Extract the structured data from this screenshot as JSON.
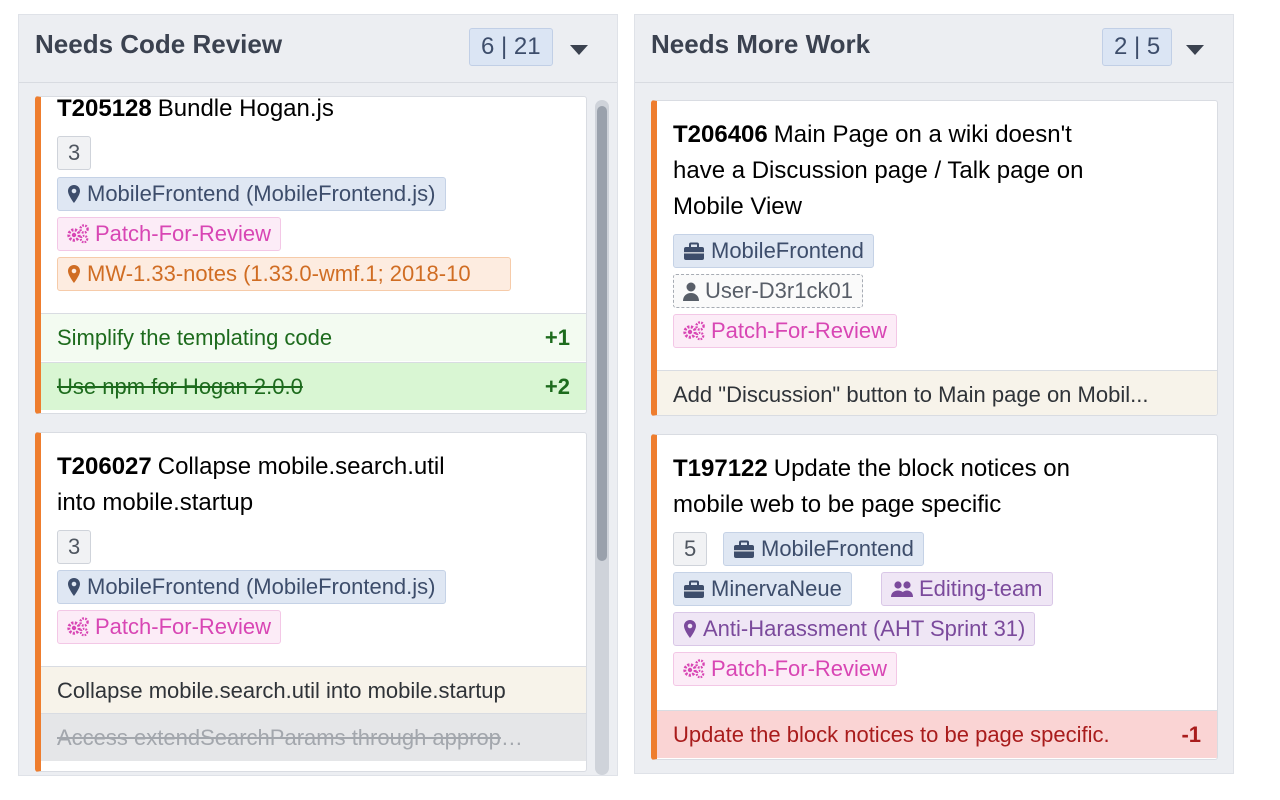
{
  "columns": [
    {
      "title": "Needs Code Review",
      "count": "6 | 21",
      "cards": [
        {
          "id": "T205128",
          "title": "Bundle Hogan.js",
          "points": "3",
          "tags": [
            {
              "label": "MobileFrontend (MobileFrontend.js)",
              "icon": "map-pin-icon"
            },
            {
              "label": "Patch-For-Review",
              "icon": "cogs-icon"
            },
            {
              "label": "MW-1.33-notes (1.33.0-wmf.1; 2018-10",
              "icon": "map-pin-icon"
            }
          ],
          "revisions": [
            {
              "text": "Simplify the templating code",
              "score": "+1"
            },
            {
              "text": "Use npm for Hogan 2.0.0",
              "score": "+2"
            }
          ]
        },
        {
          "id": "T206027",
          "title_line1": "Collapse mobile.search.util",
          "title_line2": "into mobile.startup",
          "points": "3",
          "tags": [
            {
              "label": "MobileFrontend (MobileFrontend.js)",
              "icon": "map-pin-icon"
            },
            {
              "label": "Patch-For-Review",
              "icon": "cogs-icon"
            }
          ],
          "revisions": [
            {
              "text": "Collapse mobile.search.util into mobile.startup",
              "score": ""
            },
            {
              "text": "Access extendSearchParams through appropri...",
              "score": ""
            }
          ]
        }
      ]
    },
    {
      "title": "Needs More Work",
      "count": "2 | 5",
      "cards": [
        {
          "id": "T206406",
          "title_line1": "Main Page on a wiki doesn't",
          "title_line2": "have a Discussion page / Talk page on",
          "title_line3": "Mobile View",
          "tags": [
            {
              "label": "MobileFrontend",
              "icon": "briefcase-icon"
            },
            {
              "label": "User-D3r1ck01",
              "icon": "user-icon"
            },
            {
              "label": "Patch-For-Review",
              "icon": "cogs-icon"
            }
          ],
          "revisions": [
            {
              "text": "Add \"Discussion\" button to Main page on Mobil...",
              "score": ""
            }
          ]
        },
        {
          "id": "T197122",
          "title_line1": "Update the block notices on",
          "title_line2": "mobile web to be page specific",
          "points": "5",
          "tags": [
            {
              "label": "MobileFrontend",
              "icon": "briefcase-icon"
            },
            {
              "label": "MinervaNeue",
              "icon": "briefcase-icon"
            },
            {
              "label": "Editing-team",
              "icon": "users-icon"
            },
            {
              "label": "Anti-Harassment (AHT Sprint 31)",
              "icon": "map-pin-icon"
            },
            {
              "label": "Patch-For-Review",
              "icon": "cogs-icon"
            }
          ],
          "revisions": [
            {
              "text": "Update the block notices to be page specific.",
              "score": "-1"
            }
          ]
        }
      ]
    }
  ],
  "colors": {
    "card_border_accent": "#ee7d2e",
    "project_tag": "#3d4d6b",
    "patch_tag": "#d846b4",
    "milestone_tag": "#d06d23",
    "team_tag": "#7b4a9c"
  }
}
